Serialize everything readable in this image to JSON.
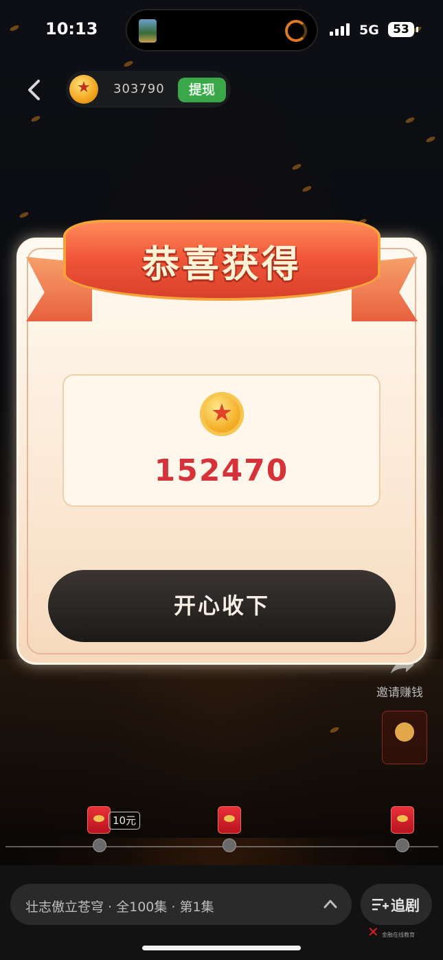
{
  "status_bar": {
    "time": "10:13",
    "network": "5G",
    "battery": "53"
  },
  "header": {
    "coin_count": "303790",
    "withdraw_label": "提现"
  },
  "dialog": {
    "title": "恭喜获得",
    "reward_amount": "152470",
    "accept_label": "开心收下"
  },
  "side": {
    "invite_label": "邀请赚钱"
  },
  "progress": {
    "reward_tag": "10元"
  },
  "bottom_bar": {
    "episode_info": "壮志傲立苍穹 · 全100集 · 第1集",
    "follow_label": "追剧",
    "watermark": "金融在线教育"
  },
  "colors": {
    "withdraw_bg": "#3aa84a",
    "reward_amount": "#d63239",
    "ribbon": "#ef5438",
    "accept_button": "#1c1a19"
  }
}
